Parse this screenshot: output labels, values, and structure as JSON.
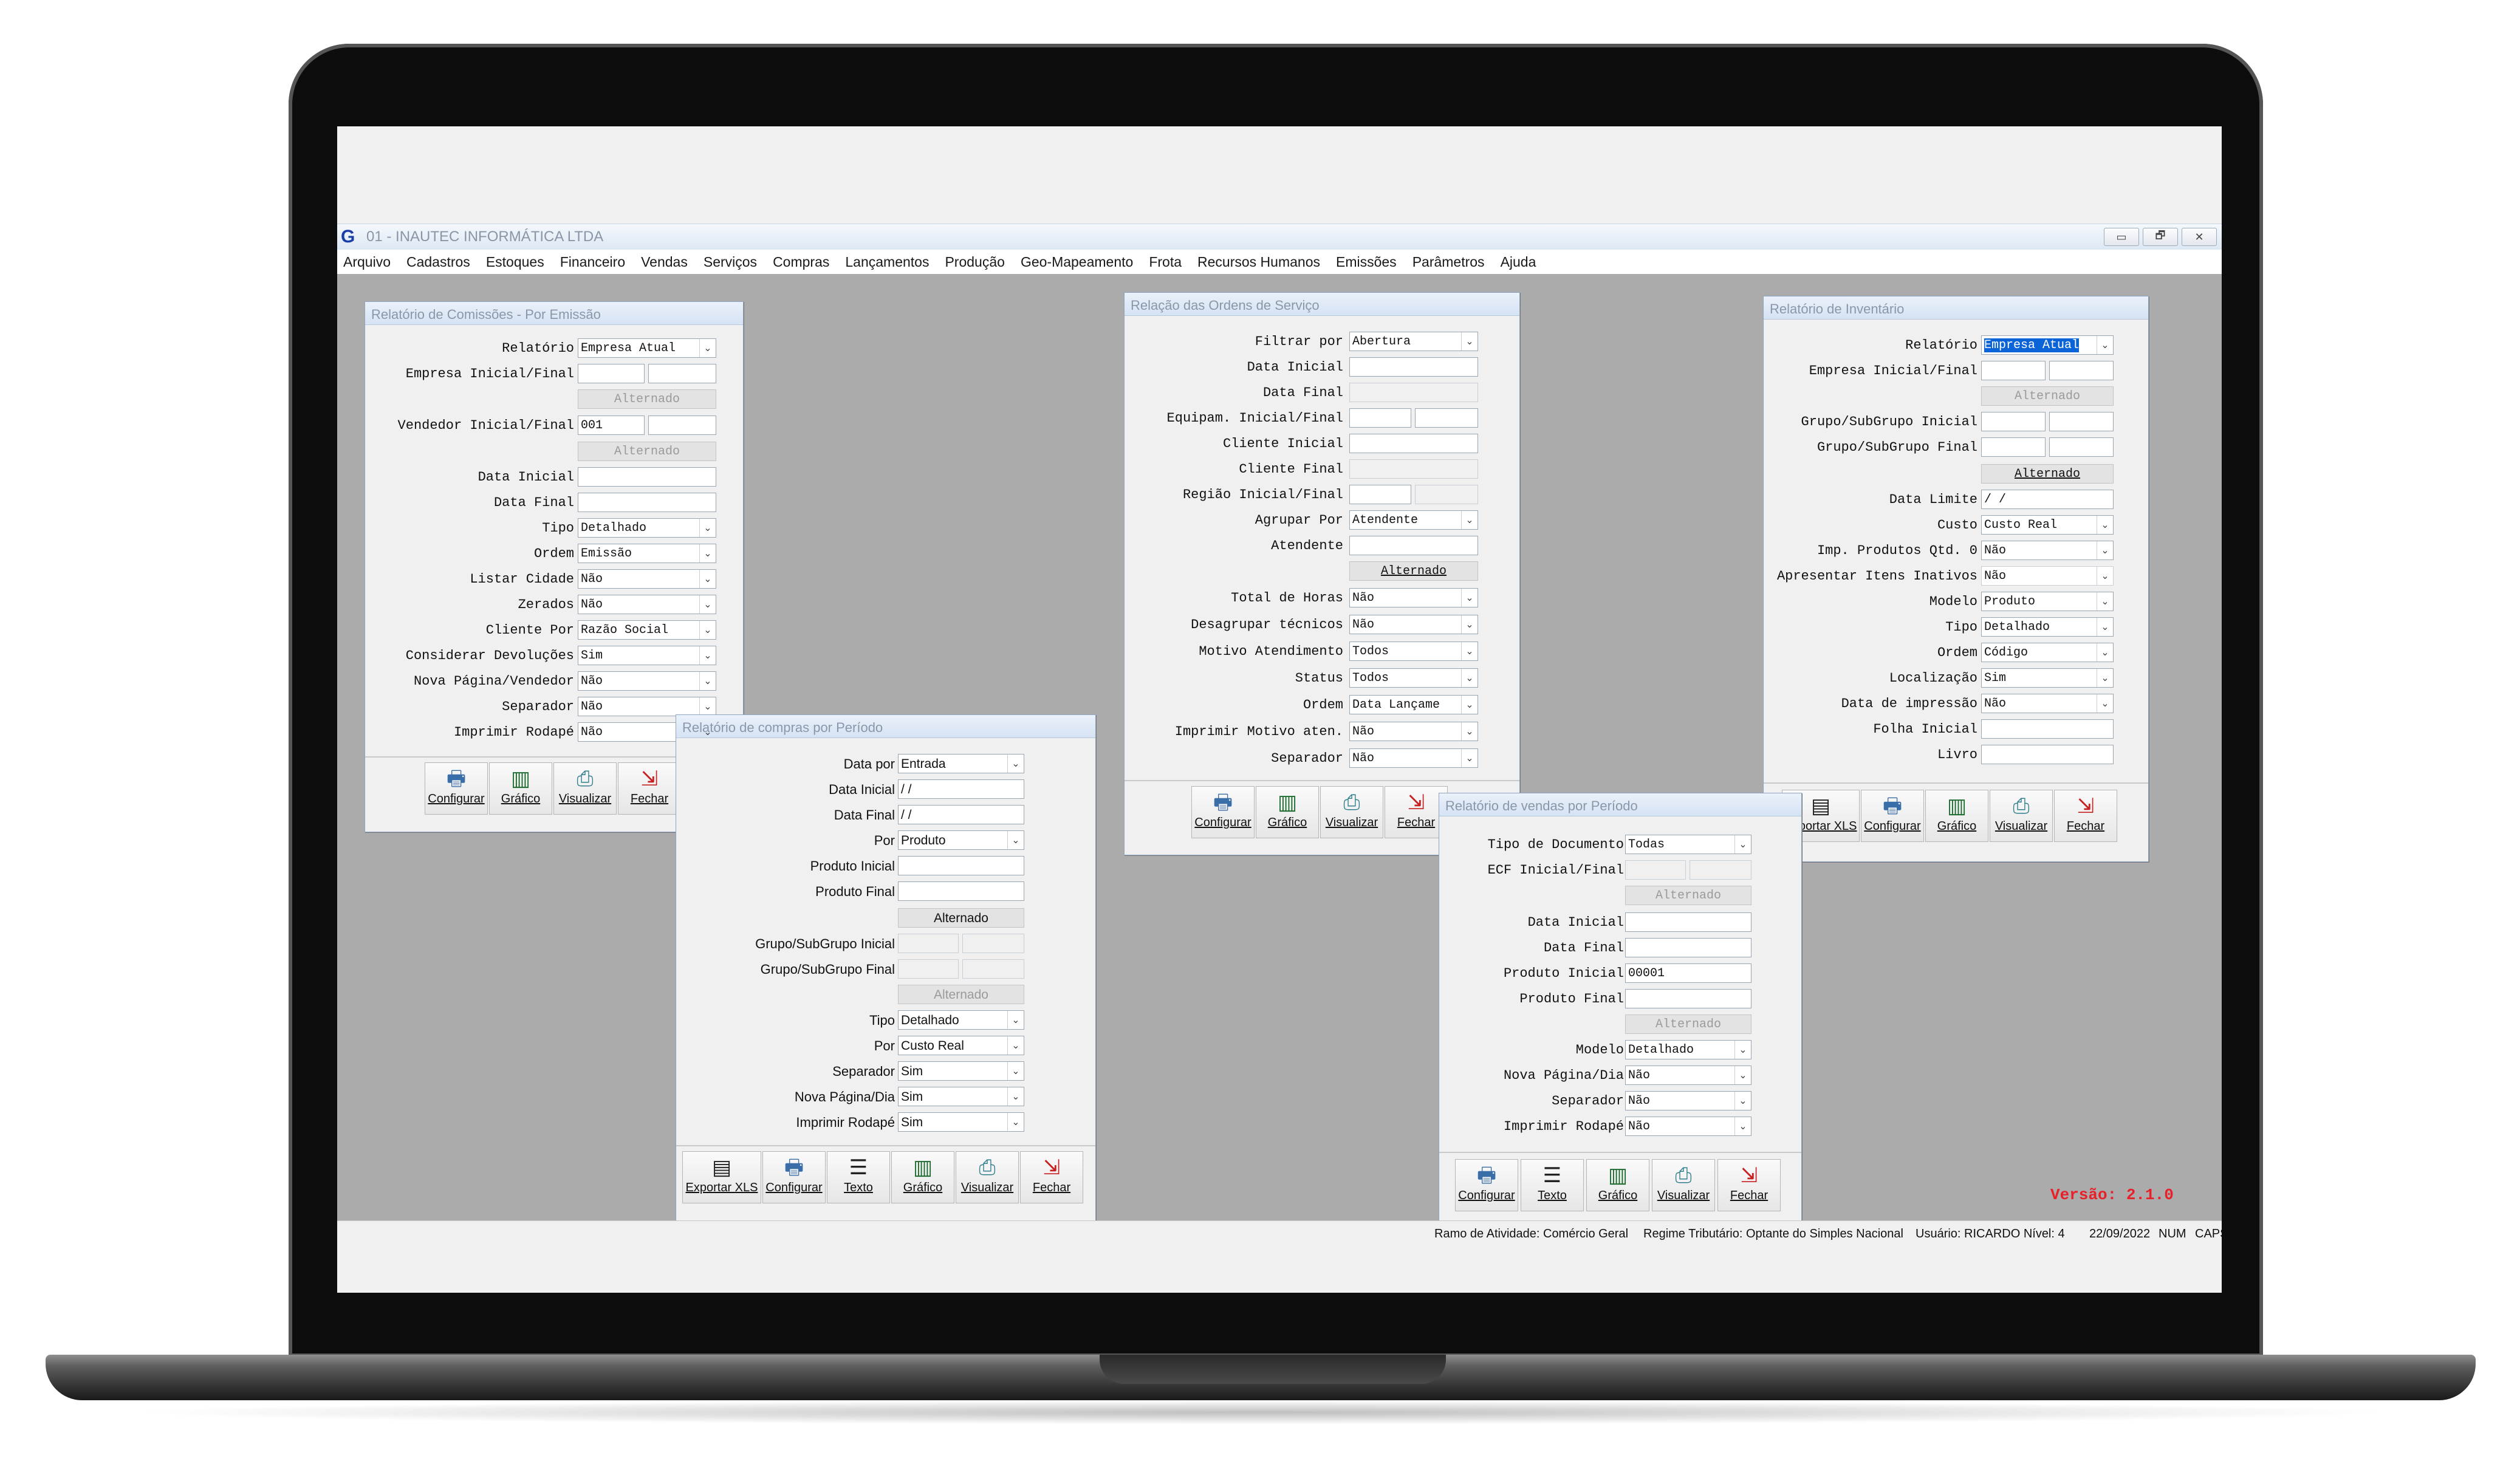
{
  "app": {
    "logo": "G",
    "title": "01 - INAUTEC INFORMÁTICA LTDA",
    "window_buttons": [
      "▭",
      "🗗",
      "✕"
    ]
  },
  "menu": [
    "Arquivo",
    "Cadastros",
    "Estoques",
    "Financeiro",
    "Vendas",
    "Serviços",
    "Compras",
    "Lançamentos",
    "Produção",
    "Geo-Mapeamento",
    "Frota",
    "Recursos Humanos",
    "Emissões",
    "Parâmetros",
    "Ajuda"
  ],
  "status": {
    "ramo": "Ramo de Atividade: Comércio Geral",
    "regime": "Regime Tributário: Optante do Simples Nacional",
    "usuario": "Usuário: RICARDO Nível: 4",
    "data": "22/09/2022",
    "num": "NUM",
    "caps": "CAPS"
  },
  "version": "Versão: 2.1.0",
  "labels": {
    "alternado": "Alternado",
    "configurar": "Configurar",
    "grafico": "Gráfico",
    "visualizar": "Visualizar",
    "fechar": "Fechar",
    "exportar_xls": "Exportar XLS",
    "texto": "Texto"
  },
  "icons": {
    "configurar": "printer-icon",
    "grafico": "chart-icon",
    "visualizar": "preview-icon",
    "fechar": "exit-door-icon",
    "exportar_xls": "spreadsheet-icon",
    "texto": "text-document-icon"
  },
  "comissoes": {
    "title": "Relatório de Comissões - Por Emissão",
    "relatorio": {
      "label": "Relatório",
      "value": "Empresa Atual"
    },
    "empresa": {
      "label": "Empresa Inicial/Final"
    },
    "vendedor": {
      "label": "Vendedor Inicial/Final",
      "value": "001"
    },
    "data_inicial": {
      "label": "Data Inicial"
    },
    "data_final": {
      "label": "Data Final"
    },
    "tipo": {
      "label": "Tipo",
      "value": "Detalhado"
    },
    "ordem": {
      "label": "Ordem",
      "value": "Emissão"
    },
    "listar_cidade": {
      "label": "Listar Cidade",
      "value": "Não"
    },
    "zerados": {
      "label": "Zerados",
      "value": "Não"
    },
    "cliente_por": {
      "label": "Cliente Por",
      "value": "Razão Social"
    },
    "considerar_devolucoes": {
      "label": "Considerar Devoluções",
      "value": "Sim"
    },
    "nova_pagina": {
      "label": "Nova Página/Vendedor",
      "value": "Não"
    },
    "separador": {
      "label": "Separador",
      "value": "Não"
    },
    "imprimir_rodape": {
      "label": "Imprimir Rodapé",
      "value": "Não"
    }
  },
  "compras": {
    "title": "Relatório de compras por Período",
    "data_por": {
      "label": "Data por",
      "value": "Entrada"
    },
    "data_inicial": {
      "label": "Data Inicial",
      "value": " /  /"
    },
    "data_final": {
      "label": "Data Final",
      "value": " /  /"
    },
    "por": {
      "label": "Por",
      "value": "Produto"
    },
    "produto_inicial": {
      "label": "Produto Inicial"
    },
    "produto_final": {
      "label": "Produto Final"
    },
    "grupo_inicial": {
      "label": "Grupo/SubGrupo Inicial"
    },
    "grupo_final": {
      "label": "Grupo/SubGrupo Final"
    },
    "tipo": {
      "label": "Tipo",
      "value": "Detalhado"
    },
    "por2": {
      "label": "Por",
      "value": "Custo Real"
    },
    "separador": {
      "label": "Separador",
      "value": "Sim"
    },
    "nova_pagina": {
      "label": "Nova Página/Dia",
      "value": "Sim"
    },
    "imprimir_rodape": {
      "label": "Imprimir Rodapé",
      "value": "Sim"
    }
  },
  "ordens": {
    "title": "Relação das Ordens de Serviço",
    "filtrar_por": {
      "label": "Filtrar por",
      "value": "Abertura"
    },
    "data_inicial": {
      "label": "Data Inicial"
    },
    "data_final": {
      "label": "Data Final"
    },
    "equipam": {
      "label": "Equipam. Inicial/Final"
    },
    "cliente_inicial": {
      "label": "Cliente Inicial"
    },
    "cliente_final": {
      "label": "Cliente Final"
    },
    "regiao": {
      "label": "Região Inicial/Final"
    },
    "agrupar_por": {
      "label": "Agrupar Por",
      "value": "Atendente"
    },
    "atendente": {
      "label": "Atendente"
    },
    "total_horas": {
      "label": "Total de Horas",
      "value": "Não"
    },
    "desagrupar": {
      "label": "Desagrupar técnicos",
      "value": "Não"
    },
    "motivo": {
      "label": "Motivo Atendimento",
      "value": "Todos"
    },
    "status": {
      "label": "Status",
      "value": "Todos"
    },
    "ordem": {
      "label": "Ordem",
      "value": "Data Lançame"
    },
    "imprimir_motivo": {
      "label": "Imprimir Motivo aten.",
      "value": "Não"
    },
    "separador": {
      "label": "Separador",
      "value": "Não"
    }
  },
  "vendas": {
    "title": "Relatório de vendas por Período",
    "tipo_documento": {
      "label": "Tipo de Documento",
      "value": "Todas"
    },
    "ecf": {
      "label": "ECF Inicial/Final"
    },
    "data_inicial": {
      "label": "Data Inicial"
    },
    "data_final": {
      "label": "Data Final"
    },
    "produto_inicial": {
      "label": "Produto Inicial",
      "value": "00001"
    },
    "produto_final": {
      "label": "Produto Final"
    },
    "modelo": {
      "label": "Modelo",
      "value": "Detalhado"
    },
    "nova_pagina": {
      "label": "Nova Página/Dia",
      "value": "Não"
    },
    "separador": {
      "label": "Separador",
      "value": "Não"
    },
    "imprimir_rodape": {
      "label": "Imprimir Rodapé",
      "value": "Não"
    }
  },
  "inventario": {
    "title": "Relatório de Inventário",
    "relatorio": {
      "label": "Relatório",
      "value": "Empresa Atual"
    },
    "empresa": {
      "label": "Empresa Inicial/Final"
    },
    "grupo_inicial": {
      "label": "Grupo/SubGrupo Inicial"
    },
    "grupo_final": {
      "label": "Grupo/SubGrupo Final"
    },
    "data_limite": {
      "label": "Data Limite",
      "value": " /  /"
    },
    "custo": {
      "label": "Custo",
      "value": "Custo Real"
    },
    "imp_produtos": {
      "label": "Imp. Produtos Qtd. 0",
      "value": "Não"
    },
    "apresentar_inativos": {
      "label": "Apresentar Itens Inativos",
      "value": "Não"
    },
    "modelo": {
      "label": "Modelo",
      "value": "Produto"
    },
    "tipo": {
      "label": "Tipo",
      "value": "Detalhado"
    },
    "ordem": {
      "label": "Ordem",
      "value": "Código"
    },
    "localizacao": {
      "label": "Localização",
      "value": "Sim"
    },
    "data_impressao": {
      "label": "Data de impressão",
      "value": "Não"
    },
    "folha_inicial": {
      "label": "Folha Inicial"
    },
    "livro": {
      "label": "Livro"
    }
  }
}
